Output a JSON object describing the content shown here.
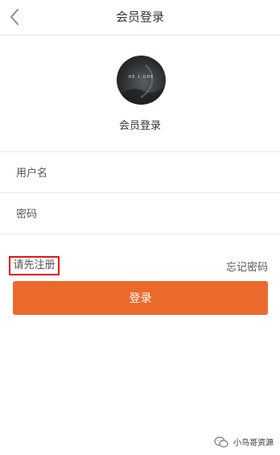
{
  "header": {
    "title": "会员登录",
    "back_icon": "chevron-left-icon"
  },
  "profile": {
    "avatar_caption": "HE 1.UHE",
    "label": "会员登录"
  },
  "form": {
    "username_placeholder": "用户名",
    "password_placeholder": "密码",
    "username_value": "",
    "password_value": ""
  },
  "links": {
    "register": "请先注册",
    "forgot_password": "忘记密码"
  },
  "actions": {
    "login_label": "登录"
  },
  "watermark": {
    "icon": "wechat-icon",
    "text": "小鸟哥资源"
  },
  "colors": {
    "accent": "#eb6a2b",
    "highlight_border": "#e3141a"
  }
}
